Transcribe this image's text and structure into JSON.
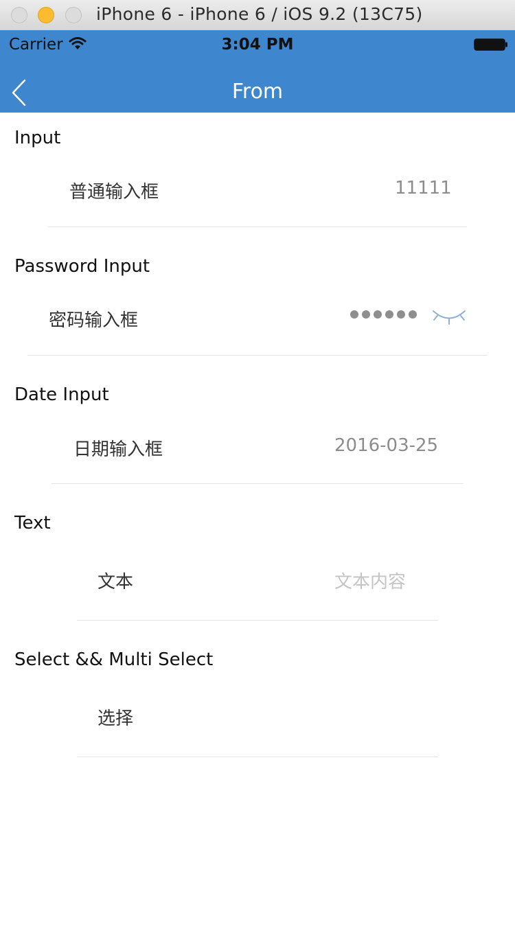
{
  "window": {
    "title": "iPhone 6 - iPhone 6 / iOS 9.2 (13C75)",
    "controls": [
      "close",
      "minimize",
      "zoom"
    ]
  },
  "status_bar": {
    "carrier": "Carrier",
    "time": "3:04 PM",
    "icons": [
      "wifi-icon",
      "battery-icon"
    ]
  },
  "nav": {
    "title": "From",
    "back_icon": "chevron-left-icon",
    "background": "#3e86cd"
  },
  "form": {
    "input": {
      "section": "Input",
      "label": "普通输入框",
      "value": "11111"
    },
    "password": {
      "section": "Password Input",
      "label": "密码输入框",
      "dot_count": 6,
      "eye_icon": "eye-closed-icon"
    },
    "date": {
      "section": "Date Input",
      "label": "日期输入框",
      "value": "2016-03-25"
    },
    "text": {
      "section": "Text",
      "label": "文本",
      "placeholder": "文本内容"
    },
    "select": {
      "section": "Select && Multi Select",
      "label": "选择"
    }
  }
}
